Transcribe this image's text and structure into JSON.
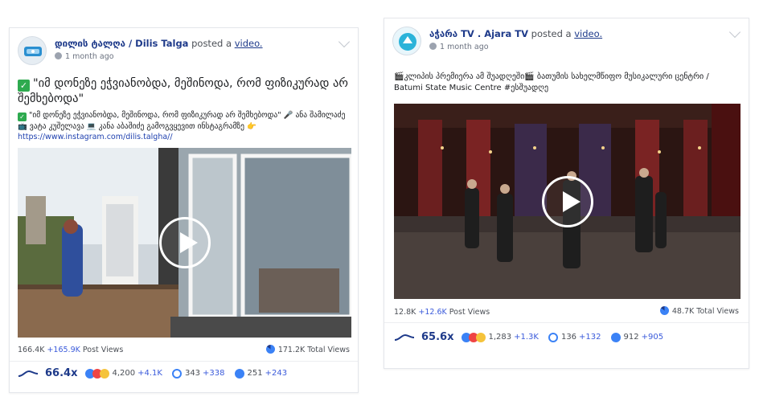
{
  "posts": [
    {
      "page_name": "დილის ტალღა / Dilis Talga",
      "action": "posted a",
      "action_link": "video.",
      "time": "1 month ago",
      "title": "\"იმ დონეზე ეჭვიანობდა, მეშინოდა, რომ ფიზიკურად არ შემხებოდა\"",
      "description": "\"იმ დონეზე ეჭვიანობდა, მეშინოდა, რომ ფიზიკურად არ შემხებოდა\" 🎤 ანა შამილაძე 📺 ვატა კუშელავა 💻 კანა აბაშიძე გამოგვყევით ინსტაგრამზე 👉",
      "url": "https://www.instagram.com/dilis.talgha//",
      "post_views": "166.4K",
      "post_views_delta": "+165.9K",
      "post_views_label": "Post Views",
      "total_views": "171.2K Total Views",
      "speed": "66.4x",
      "reactions": "4,200",
      "reactions_delta": "+4.1K",
      "comments": "343",
      "comments_delta": "+338",
      "shares": "251",
      "shares_delta": "+243"
    },
    {
      "page_name": "აჭარა TV . Ajara TV",
      "action": "posted a",
      "action_link": "video.",
      "time": "1 month ago",
      "description": "🎬კლიპის პრემიერა ამ შუადღეში🎬 ბათუმის სახელმწიფო მუსიკალური ცენტრი / Batumi State Music Centre #ესშუადღე",
      "post_views": "12.8K",
      "post_views_delta": "+12.6K",
      "post_views_label": "Post Views",
      "total_views": "48.7K Total Views",
      "speed": "65.6x",
      "reactions": "1,283",
      "reactions_delta": "+1.3K",
      "comments": "136",
      "comments_delta": "+132",
      "shares": "912",
      "shares_delta": "+905"
    }
  ],
  "icons": [
    "check-icon",
    "globe-icon",
    "chevron-down-icon",
    "play-icon",
    "views-pie-icon",
    "speed-wave-icon",
    "reactions-icon",
    "comment-icon",
    "share-icon"
  ],
  "colors": {
    "accent": "#3b5bdb",
    "page_link": "#1e3a8a",
    "check": "#2eaa4f"
  }
}
